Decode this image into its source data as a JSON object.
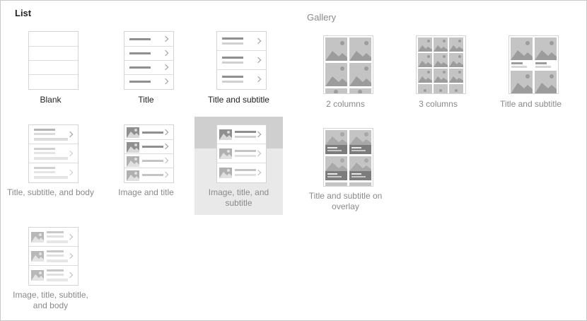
{
  "list": {
    "title": "List",
    "layouts": [
      {
        "label": "Blank"
      },
      {
        "label": "Title"
      },
      {
        "label": "Title and subtitle"
      },
      {
        "label": "Title, subtitle, and body"
      },
      {
        "label": "Image and title"
      },
      {
        "label": "Image, title, and subtitle",
        "selected": true
      },
      {
        "label": "Image, title, subtitle, and body"
      }
    ]
  },
  "gallery": {
    "title": "Gallery",
    "layouts": [
      {
        "label": "2 columns"
      },
      {
        "label": "3 columns"
      },
      {
        "label": "Title and subtitle"
      },
      {
        "label": "Title and subtitle on overlay"
      }
    ]
  },
  "colors": {
    "frame_border": "#c8c8c8",
    "selected_background": "#e9e9e9",
    "selected_band": "#cfcfcf",
    "caption_dark": "#222222",
    "caption_muted": "#8a8a8a",
    "placeholder_dark": "#8f8f8f",
    "placeholder_light": "#c4c4c4"
  }
}
